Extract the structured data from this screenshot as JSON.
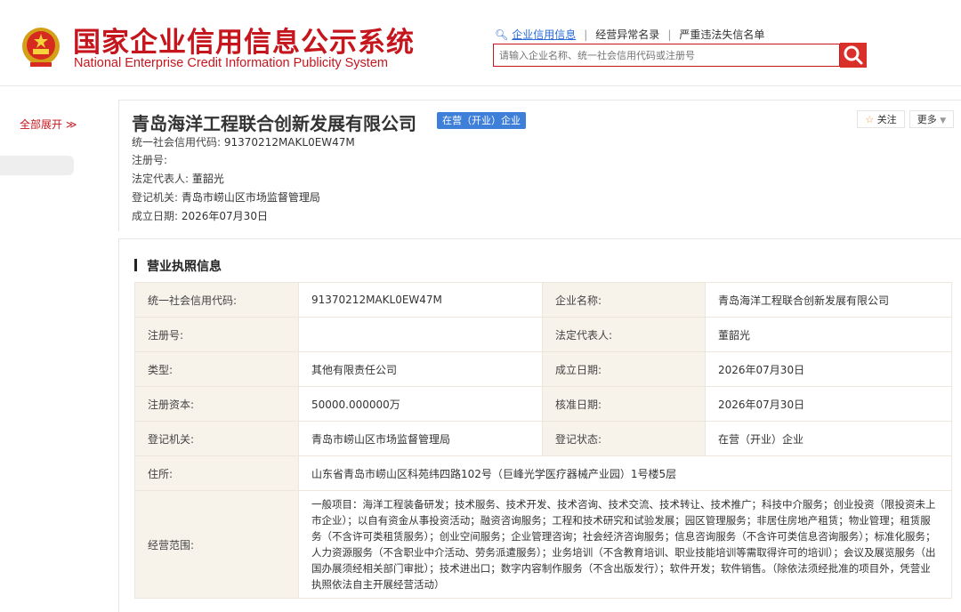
{
  "header": {
    "title_cn": "国家企业信用信息公示系统",
    "title_en": "National Enterprise Credit Information Publicity System",
    "nav_links": [
      "企业信用信息",
      "经营异常名录",
      "严重违法失信名单"
    ],
    "search_placeholder": "请输入企业名称、统一社会信用代码或注册号",
    "icons": [
      "national-emblem-icon",
      "search-icon"
    ]
  },
  "sidebar": {
    "expand_all_label": "全部展开 ≫"
  },
  "company": {
    "name": "青岛海洋工程联合创新发展有限公司",
    "status_tag": "在营（开业）企业",
    "follow_label": "关注",
    "more_label": "更多",
    "summary": [
      {
        "label": "统一社会信用代码:",
        "value": "91370212MAKL0EW47M"
      },
      {
        "label": "注册号:",
        "value": ""
      },
      {
        "label": "法定代表人:",
        "value": "董韶光"
      },
      {
        "label": "登记机关:",
        "value": "青岛市崂山区市场监督管理局"
      },
      {
        "label": "成立日期:",
        "value": "2026年07月30日"
      }
    ]
  },
  "license": {
    "section_title": "营业执照信息",
    "rows": [
      {
        "l1": "统一社会信用代码:",
        "v1": "91370212MAKL0EW47M",
        "l2": "企业名称:",
        "v2": "青岛海洋工程联合创新发展有限公司"
      },
      {
        "l1": "注册号:",
        "v1": "",
        "l2": "法定代表人:",
        "v2": "董韶光"
      },
      {
        "l1": "类型:",
        "v1": "其他有限责任公司",
        "l2": "成立日期:",
        "v2": "2026年07月30日"
      },
      {
        "l1": "注册资本:",
        "v1": "50000.000000万",
        "l2": "核准日期:",
        "v2": "2026年07月30日"
      },
      {
        "l1": "登记机关:",
        "v1": "青岛市崂山区市场监督管理局",
        "l2": "登记状态:",
        "v2": "在营（开业）企业"
      }
    ],
    "address_label": "住所:",
    "address_value": "山东省青岛市崂山区科苑纬四路102号（巨峰光学医疗器械产业园）1号楼5层",
    "scope_label": "经营范围:",
    "scope_value": "一般项目：海洋工程装备研发；技术服务、技术开发、技术咨询、技术交流、技术转让、技术推广；科技中介服务；创业投资（限投资未上市企业）；以自有资金从事投资活动；融资咨询服务；工程和技术研究和试验发展；园区管理服务；非居住房地产租赁；物业管理；租赁服务（不含许可类租赁服务）；创业空间服务；企业管理咨询；社会经济咨询服务；信息咨询服务（不含许可类信息咨询服务）；标准化服务；人力资源服务（不含职业中介活动、劳务派遣服务）；业务培训（不含教育培训、职业技能培训等需取得许可的培训）；会议及展览服务（出国办展须经相关部门审批）；技术进出口；数字内容制作服务（不含出版发行）；软件开发；软件销售。（除依法须经批准的项目外，凭营业执照依法自主开展经营活动）"
  },
  "colors": {
    "brand_red": "#c5161d",
    "tag_blue": "#3d7fd9",
    "label_bg": "#f7f2ea"
  }
}
